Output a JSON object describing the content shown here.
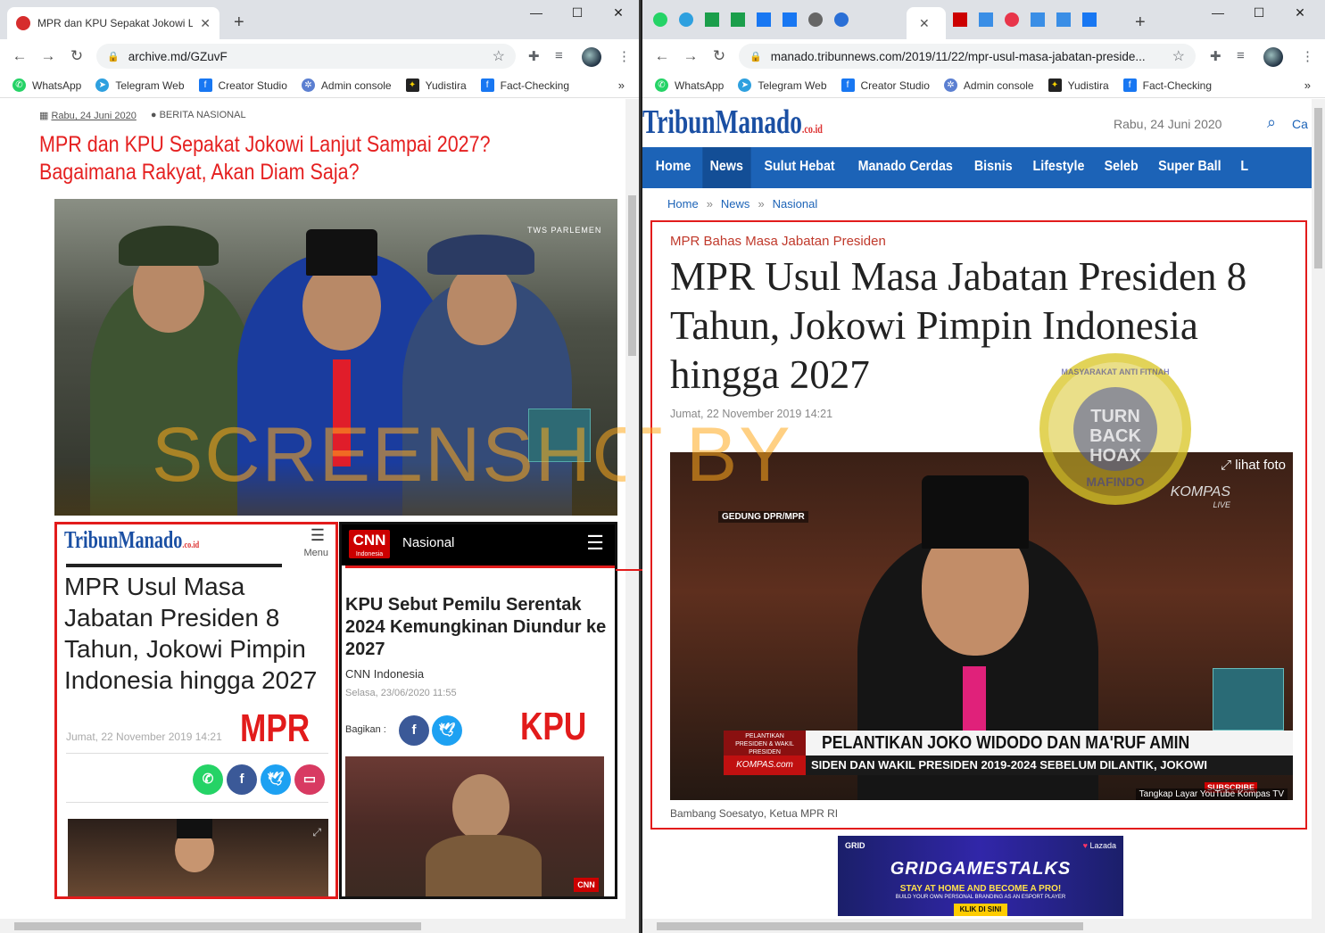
{
  "left": {
    "tab_title": "MPR dan KPU Sepakat Jokowi La",
    "url": "archive.md/GZuvF",
    "bookmarks": [
      "WhatsApp",
      "Telegram Web",
      "Creator Studio",
      "Admin console",
      "Yudistira",
      "Fact-Checking"
    ],
    "meta_date": "Rabu, 24 Juni 2020",
    "meta_category": "BERITA NASIONAL",
    "article_title": "MPR dan KPU Sepakat Jokowi Lanjut Sampai 2027? Bagaimana Rakyat, Akan Diam Saja?",
    "photo_badge": "TWS PARLEMEN",
    "watermark": "SCREENSHOT BY",
    "mpr_box": {
      "logo": "TribunManado",
      "logo_suffix": ".co.id",
      "menu": "Menu",
      "headline": "MPR Usul Masa Jabatan Presiden 8 Tahun, Jokowi Pimpin Indonesia hingga 2027",
      "date": "Jumat, 22 November 2019 14:21",
      "label": "MPR"
    },
    "kpu_box": {
      "logo": "CNN",
      "logo_sub": "Indonesia",
      "section": "Nasional",
      "headline": "KPU Sebut Pemilu Serentak 2024 Kemungkinan Diundur ke 2027",
      "source": "CNN Indonesia",
      "date": "Selasa, 23/06/2020 11:55",
      "share_label": "Bagikan :",
      "label": "KPU"
    }
  },
  "right": {
    "url": "manado.tribunnews.com/2019/11/22/mpr-usul-masa-jabatan-preside...",
    "bookmarks": [
      "WhatsApp",
      "Telegram Web",
      "Creator Studio",
      "Admin console",
      "Yudistira",
      "Fact-Checking"
    ],
    "logo": "TribunManado",
    "logo_suffix": ".co.id",
    "header_date": "Rabu, 24 Juni 2020",
    "search_label": "Ca",
    "nav": [
      "Home",
      "News",
      "Sulut Hebat",
      "Manado Cerdas",
      "Bisnis",
      "Lifestyle",
      "Seleb",
      "Super Ball",
      "L"
    ],
    "breadcrumb": [
      "Home",
      "News",
      "Nasional"
    ],
    "kicker": "MPR Bahas Masa Jabatan Presiden",
    "title": "MPR Usul Masa Jabatan Presiden 8 Tahun, Jokowi Pimpin Indonesia hingga 2027",
    "date": "Jumat, 22 November 2019 14:21",
    "photo_more": "lihat foto",
    "photo_tag": "GEDUNG DPR/MPR",
    "photo_brand": "KOMPAS",
    "photo_brand_sub": "LIVE",
    "lower_small_1": "PELANTIKAN",
    "lower_small_2": "PRESIDEN & WAKIL PRESIDEN",
    "lower_main": "PELANTIKAN JOKO WIDODO DAN MA'RUF AMIN",
    "lower_ticker": "SIDEN DAN WAKIL PRESIDEN 2019-2024   SEBELUM DILANTIK, JOKOWI",
    "lower_channel": "KOMPAS.com",
    "subscribe": "SUBSCRIBE",
    "photo_credit": "Tangkap Layar YouTube Kompas TV",
    "caption": "Bambang Soesatyo, Ketua MPR RI",
    "stamp_text_top": "MASYARAKAT ANTI FITNAH",
    "stamp_text_bottom": "MAFINDO",
    "stamp_center": "TURN BACK HOAX",
    "ad": {
      "brand": "GRID",
      "partner": "Lazada",
      "headline": "GRIDGAMESTALKS",
      "line1": "STAY AT HOME AND BECOME A PRO!",
      "line2": "BUILD YOUR OWN PERSONAL BRANDING AS AN ESPORT PLAYER",
      "cta": "KLIK DI SINI"
    }
  },
  "colors": {
    "tribun_blue": "#1c63b7",
    "red": "#e21b1b",
    "title_red": "#e52020"
  }
}
